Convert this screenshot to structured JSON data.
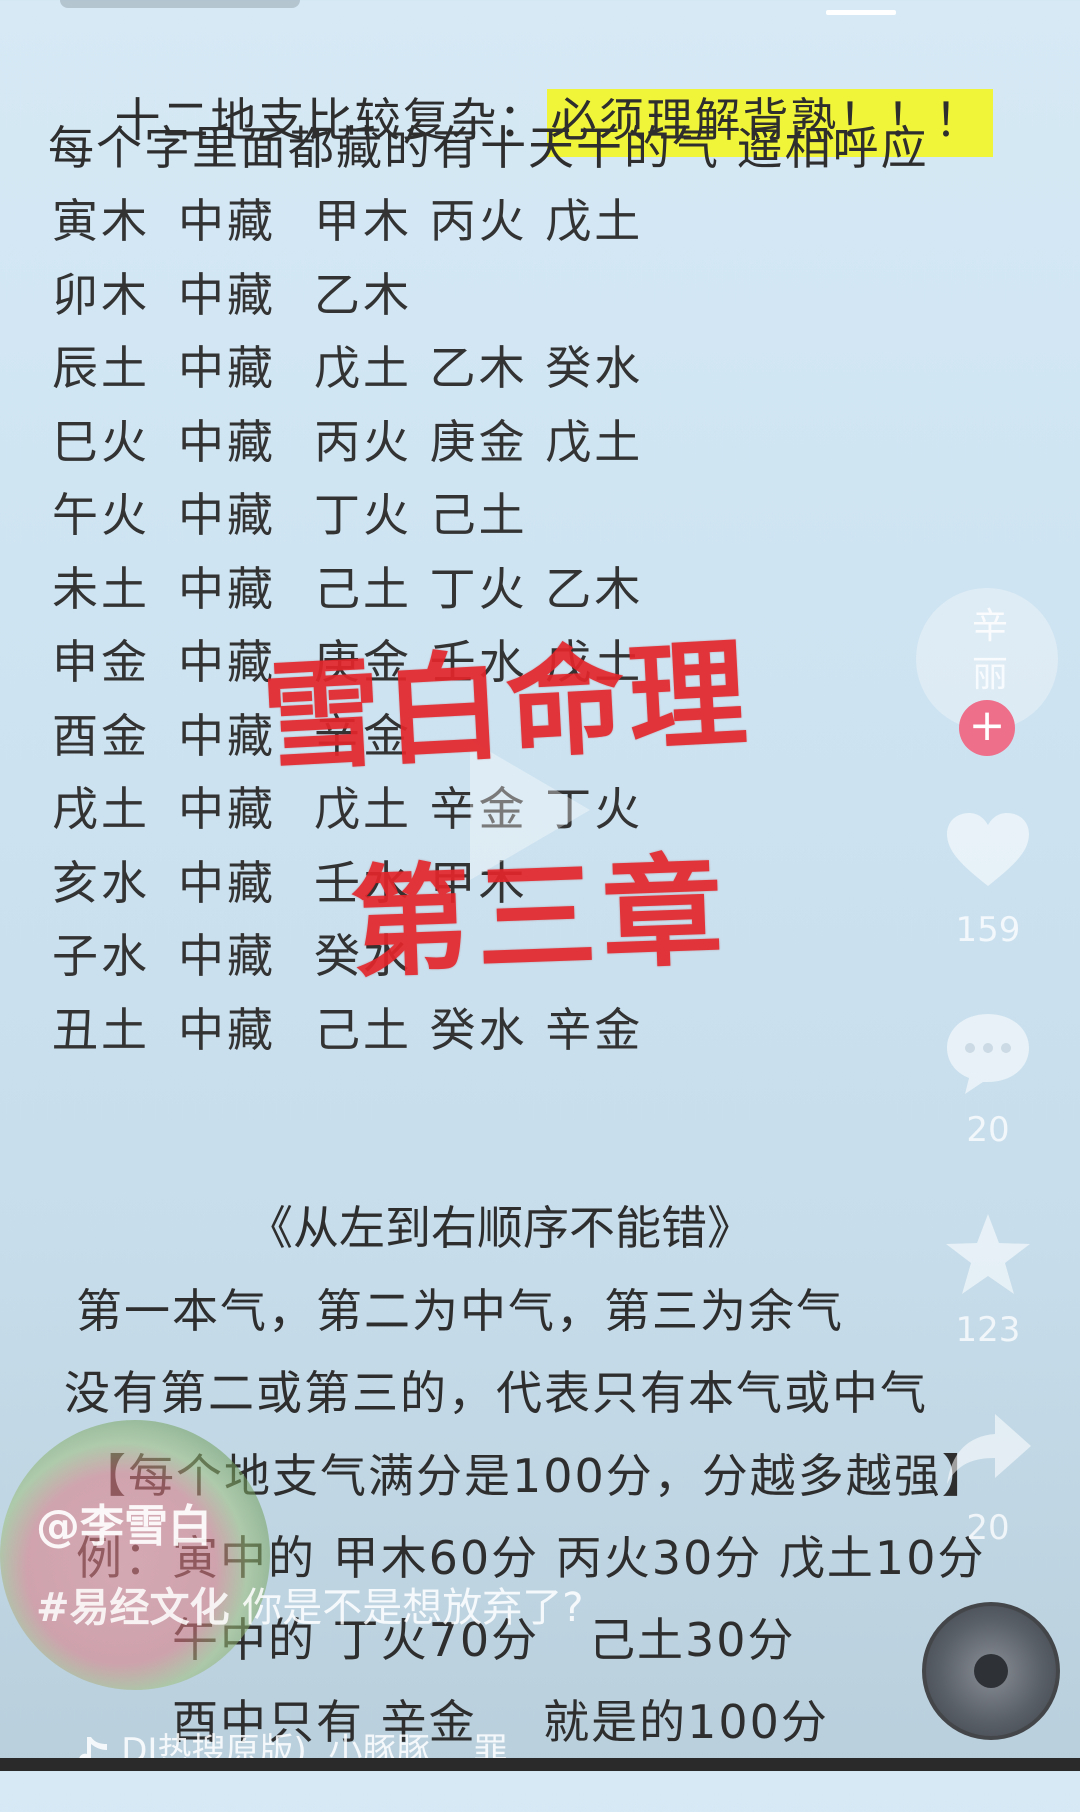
{
  "heading": {
    "prefix": "十二地支比较复杂：",
    "highlight": "必须理解背熟！！！"
  },
  "subheading": "每个字里面都藏的有十天干的气 遥相呼应",
  "rows": [
    {
      "branch": "寅木",
      "zang": "中藏",
      "stems": "甲木 丙火 戊土"
    },
    {
      "branch": "卯木",
      "zang": "中藏",
      "stems": "乙木"
    },
    {
      "branch": "辰土",
      "zang": "中藏",
      "stems": "戊土 乙木 癸水"
    },
    {
      "branch": "巳火",
      "zang": "中藏",
      "stems": "丙火 庚金 戊土"
    },
    {
      "branch": "午火",
      "zang": "中藏",
      "stems": "丁火 己土"
    },
    {
      "branch": "未土",
      "zang": "中藏",
      "stems": "己土 丁火 乙木"
    },
    {
      "branch": "申金",
      "zang": "中藏",
      "stems": "庚金 壬水 戊土"
    },
    {
      "branch": "酉金",
      "zang": "中藏",
      "stems": "辛金"
    },
    {
      "branch": "戌土",
      "zang": "中藏",
      "stems": "戊土 辛金 丁火"
    },
    {
      "branch": "亥水",
      "zang": "中藏",
      "stems": "壬水 甲木"
    },
    {
      "branch": "子水",
      "zang": "中藏",
      "stems": "癸水"
    },
    {
      "branch": "丑土",
      "zang": "中藏",
      "stems": "己土 癸水 辛金"
    }
  ],
  "order_note": "《从左到右顺序不能错》",
  "explain_1": "第一本气，第二为中气，第三为余气",
  "explain_2": "没有第二或第三的，代表只有本气或中气",
  "score_note": "【每个地支气满分是100分，分越多越强】",
  "example_1": "例：寅中的 甲木60分 丙火30分 戊土10分",
  "example_2": "午中的 丁火70分   己土30分",
  "example_3": "酉中只有 辛金    就是的100分",
  "stamp": {
    "line1": "雪白命理",
    "line2": "第三章"
  },
  "rail": {
    "avatar_text": "辛丽",
    "follow_symbol": "+",
    "likes": "159",
    "comments": "20",
    "favorites": "123",
    "shares": "20"
  },
  "author": "@李雪白",
  "caption_tag": "#易经文化",
  "caption_text": " 你是不是想放弃了?",
  "music": "DJ热搜原版)  小豚豚    罪",
  "colors": {
    "highlight": "#f1f53a",
    "stamp_red": "#e3262b",
    "follow_pink": "#ee6f8a"
  }
}
